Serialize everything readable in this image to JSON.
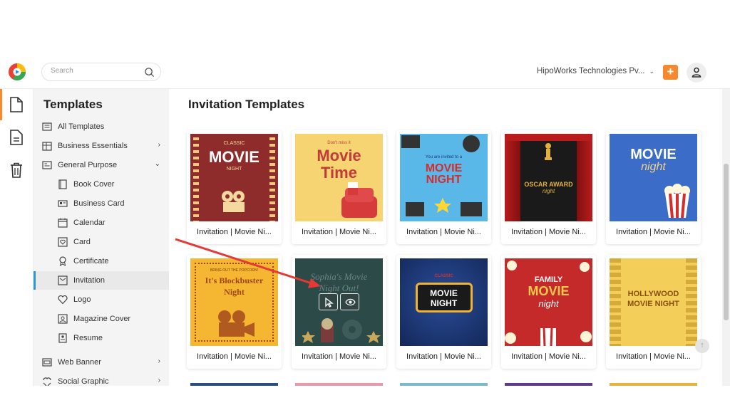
{
  "search": {
    "placeholder": "Search"
  },
  "header": {
    "company": "HipoWorks Technologies Pv...",
    "plus_label": "+"
  },
  "sidebar": {
    "title": "Templates",
    "items": [
      {
        "label": "All Templates",
        "icon": "all-templates-icon"
      },
      {
        "label": "Business Essentials",
        "icon": "business-icon",
        "expand": "›"
      },
      {
        "label": "General Purpose",
        "icon": "general-purpose-icon",
        "expand": "⌄"
      },
      {
        "label": "Book Cover",
        "icon": "book-cover-icon"
      },
      {
        "label": "Business Card",
        "icon": "business-card-icon"
      },
      {
        "label": "Calendar",
        "icon": "calendar-icon"
      },
      {
        "label": "Card",
        "icon": "card-icon"
      },
      {
        "label": "Certificate",
        "icon": "certificate-icon"
      },
      {
        "label": "Invitation",
        "icon": "invitation-icon"
      },
      {
        "label": "Logo",
        "icon": "logo-heart-icon"
      },
      {
        "label": "Magazine Cover",
        "icon": "magazine-icon"
      },
      {
        "label": "Resume",
        "icon": "resume-icon"
      },
      {
        "label": "Web Banner",
        "icon": "web-banner-icon",
        "expand": "›"
      },
      {
        "label": "Social Graphic",
        "icon": "social-graphic-icon",
        "expand": "›"
      }
    ]
  },
  "main": {
    "title": "Invitation Templates",
    "cards": [
      {
        "caption": "Invitation | Movie Ni...",
        "t1": "CLASSIC",
        "t2": "MOVIE",
        "t3": "NIGHT",
        "bg": "#8e2c2c"
      },
      {
        "caption": "Invitation | Movie Ni...",
        "t1": "Don't miss it",
        "t2": "Movie",
        "t3": "Time",
        "bg": "#f6d472"
      },
      {
        "caption": "Invitation | Movie Ni...",
        "t1": "You are invited to a",
        "t2": "MOVIE",
        "t3": "NIGHT",
        "bg": "#5ab8e8"
      },
      {
        "caption": "Invitation | Movie Ni...",
        "t1": "OSCAR AWARD",
        "t2": "night",
        "t3": "",
        "bg": "#1a1a1a"
      },
      {
        "caption": "Invitation | Movie Ni...",
        "t1": "MOVIE",
        "t2": "night",
        "t3": "",
        "bg": "#3a6cc8"
      },
      {
        "caption": "Invitation | Movie Ni...",
        "t1": "BRING OUT THE POPCORN!",
        "t2": "It's Blockbuster",
        "t3": "Night",
        "bg": "#f5b731"
      },
      {
        "caption": "Invitation | Movie Ni...",
        "t1": "Sophia's Movie",
        "t2": "Night Out!",
        "t3": "",
        "bg": "#2c4a48"
      },
      {
        "caption": "Invitation | Movie Ni...",
        "t1": "CLASSIC",
        "t2": "MOVIE",
        "t3": "NIGHT",
        "bg": "#1d3b78"
      },
      {
        "caption": "Invitation | Movie Ni...",
        "t1": "FAMILY",
        "t2": "MOVIE",
        "t3": "night",
        "bg": "#c42a2a"
      },
      {
        "caption": "Invitation | Movie Ni...",
        "t1": "HOLLYWOOD",
        "t2": "MOVIE NIGHT",
        "t3": "",
        "bg": "#f3cf5a"
      }
    ]
  },
  "colors": {
    "accent": "#f6882d",
    "selected": "#2f95d6"
  }
}
